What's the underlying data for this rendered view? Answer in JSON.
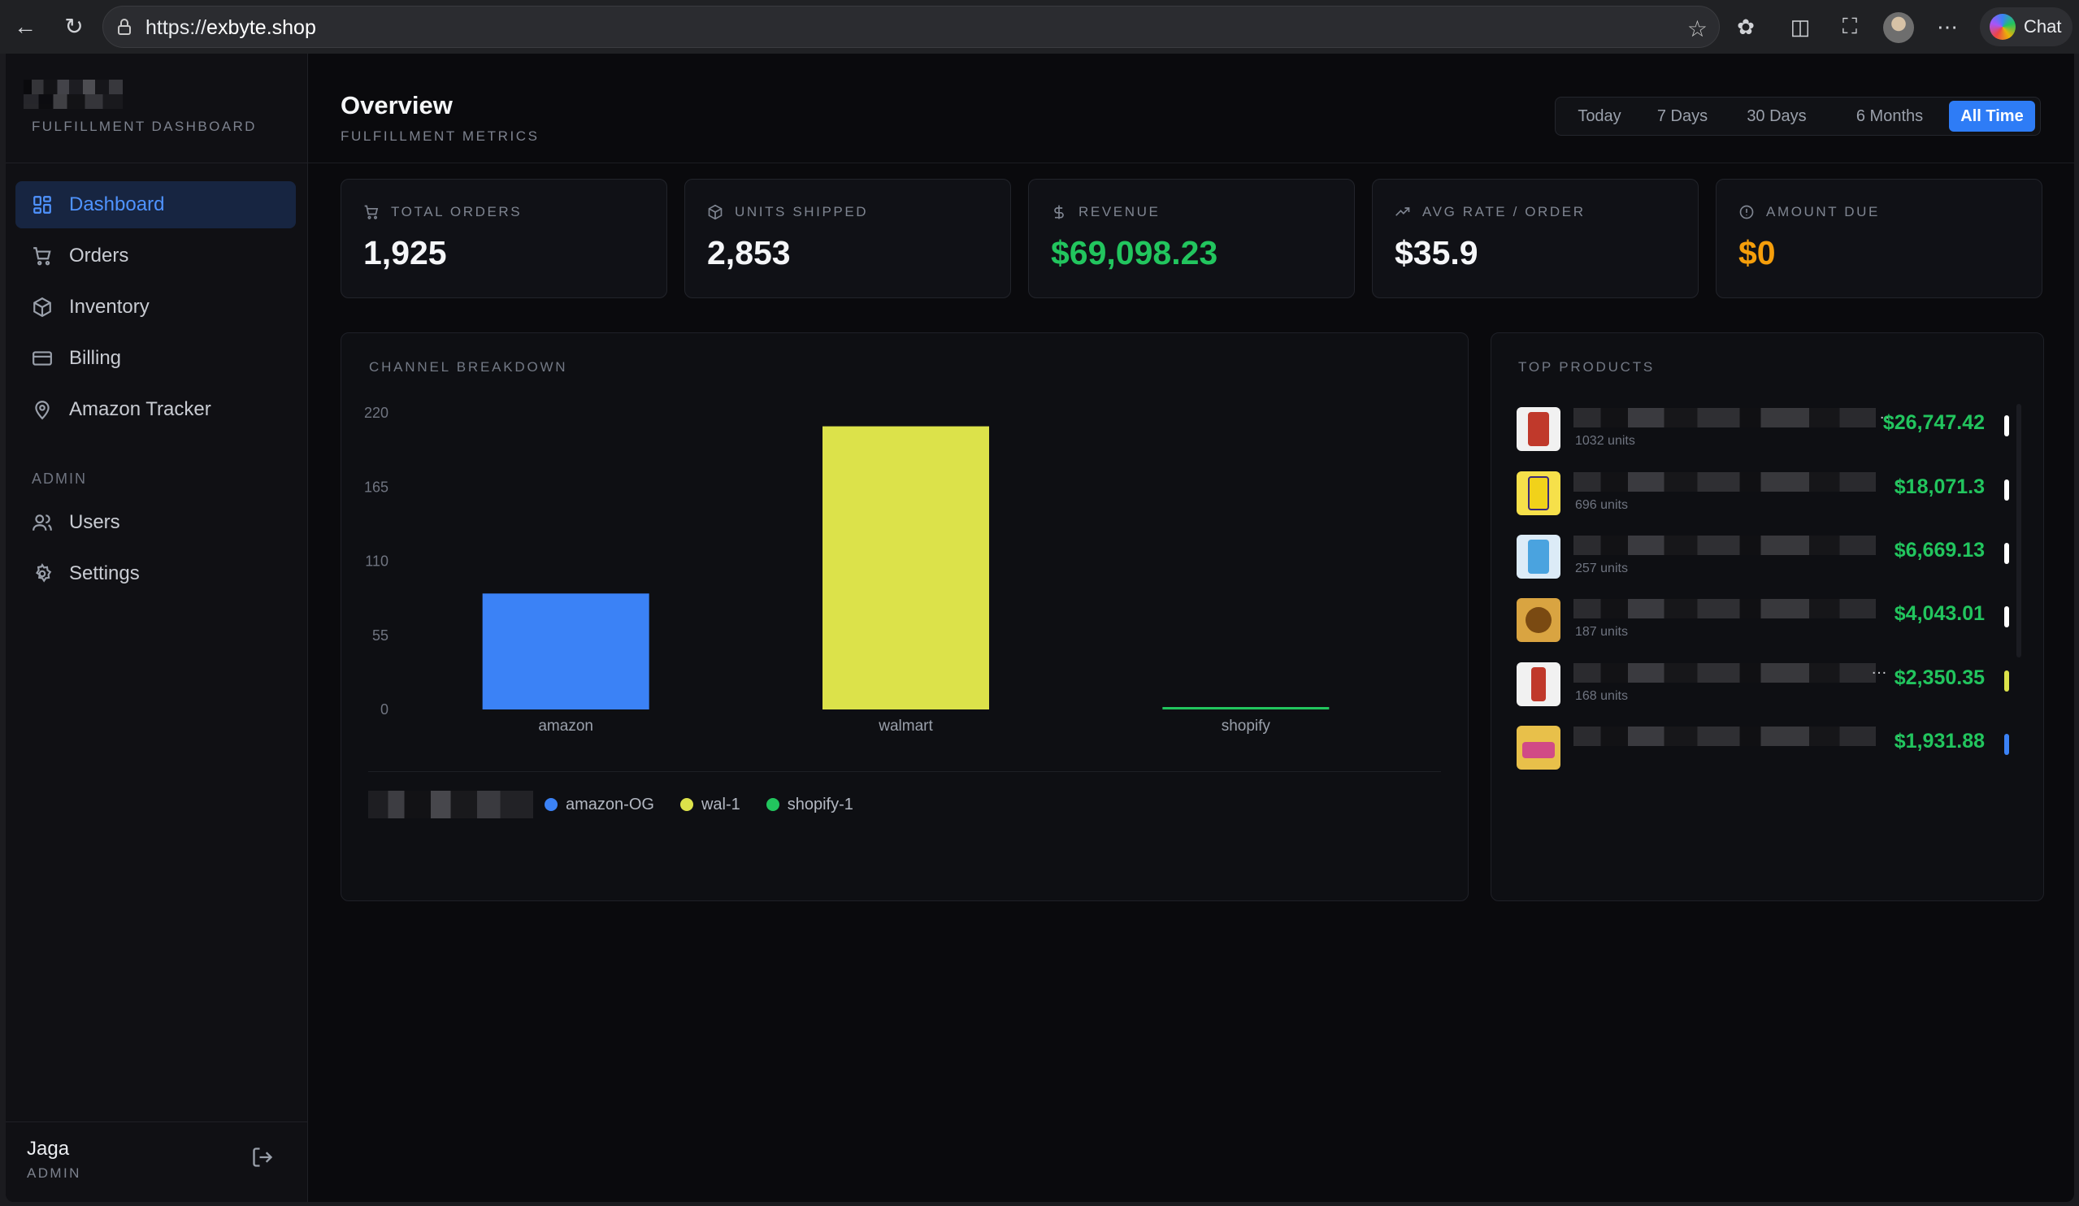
{
  "browser": {
    "url_scheme": "https://",
    "url_host": "exbyte.shop",
    "chat_label": "Chat"
  },
  "sidebar": {
    "brand_subtitle": "FULFILLMENT DASHBOARD",
    "items": [
      {
        "label": "Dashboard",
        "icon": "dashboard-icon",
        "active": true
      },
      {
        "label": "Orders",
        "icon": "cart-icon"
      },
      {
        "label": "Inventory",
        "icon": "box-icon"
      },
      {
        "label": "Billing",
        "icon": "card-icon"
      },
      {
        "label": "Amazon Tracker",
        "icon": "map-pin-icon"
      }
    ],
    "admin_section_label": "ADMIN",
    "admin_items": [
      {
        "label": "Users",
        "icon": "users-icon"
      },
      {
        "label": "Settings",
        "icon": "gear-icon"
      }
    ],
    "user": {
      "name": "Jaga",
      "role": "ADMIN"
    }
  },
  "header": {
    "title": "Overview",
    "subtitle": "FULFILLMENT METRICS"
  },
  "time_range": {
    "options": [
      "Today",
      "7 Days",
      "30 Days",
      "6 Months",
      "All Time"
    ],
    "selected": "All Time"
  },
  "stats": [
    {
      "label": "TOTAL ORDERS",
      "value": "1,925",
      "icon": "cart-icon",
      "color": "#f5f6f8"
    },
    {
      "label": "UNITS SHIPPED",
      "value": "2,853",
      "icon": "box-icon",
      "color": "#f5f6f8"
    },
    {
      "label": "REVENUE",
      "value": "$69,098.23",
      "icon": "dollar-icon",
      "color": "#22c55e"
    },
    {
      "label": "AVG RATE / ORDER",
      "value": "$35.9",
      "icon": "trending-up-icon",
      "color": "#f5f6f8"
    },
    {
      "label": "AMOUNT DUE",
      "value": "$0",
      "icon": "alert-circle-icon",
      "color": "#f59e0b"
    }
  ],
  "channel_breakdown": {
    "title": "CHANNEL BREAKDOWN",
    "legend": [
      {
        "label": "amazon-OG",
        "color": "#3b82f6"
      },
      {
        "label": "wal-1",
        "color": "#dce24a"
      },
      {
        "label": "shopify-1",
        "color": "#22c55e"
      }
    ]
  },
  "chart_data": {
    "type": "bar",
    "categories": [
      "amazon",
      "walmart",
      "shopify"
    ],
    "values": [
      86,
      210,
      1
    ],
    "colors": [
      "#3b82f6",
      "#dce24a",
      "#22c55e"
    ],
    "yticks": [
      "0",
      "55",
      "110",
      "165",
      "220"
    ],
    "ylim": [
      0,
      220
    ],
    "title": "CHANNEL BREAKDOWN"
  },
  "top_products": {
    "title": "TOP PRODUCTS",
    "items": [
      {
        "units": "1032 units",
        "revenue": "$26,747.42",
        "bar_color": "#ffffff",
        "img_color": "#c0392b"
      },
      {
        "units": "696 units",
        "revenue": "$18,071.3",
        "bar_color": "#ffffff",
        "img_color": "#f1d21a"
      },
      {
        "units": "257 units",
        "revenue": "$6,669.13",
        "bar_color": "#ffffff",
        "img_color": "#4aa3df"
      },
      {
        "units": "187 units",
        "revenue": "$4,043.01",
        "bar_color": "#ffffff",
        "img_color": "#a8741a"
      },
      {
        "units": "168 units",
        "revenue": "$2,350.35",
        "bar_color": "#dce24a",
        "img_color": "#c0392b"
      },
      {
        "units": "",
        "revenue": "$1,931.88",
        "bar_color": "#3b82f6",
        "img_color": "#e0a92a"
      }
    ]
  }
}
